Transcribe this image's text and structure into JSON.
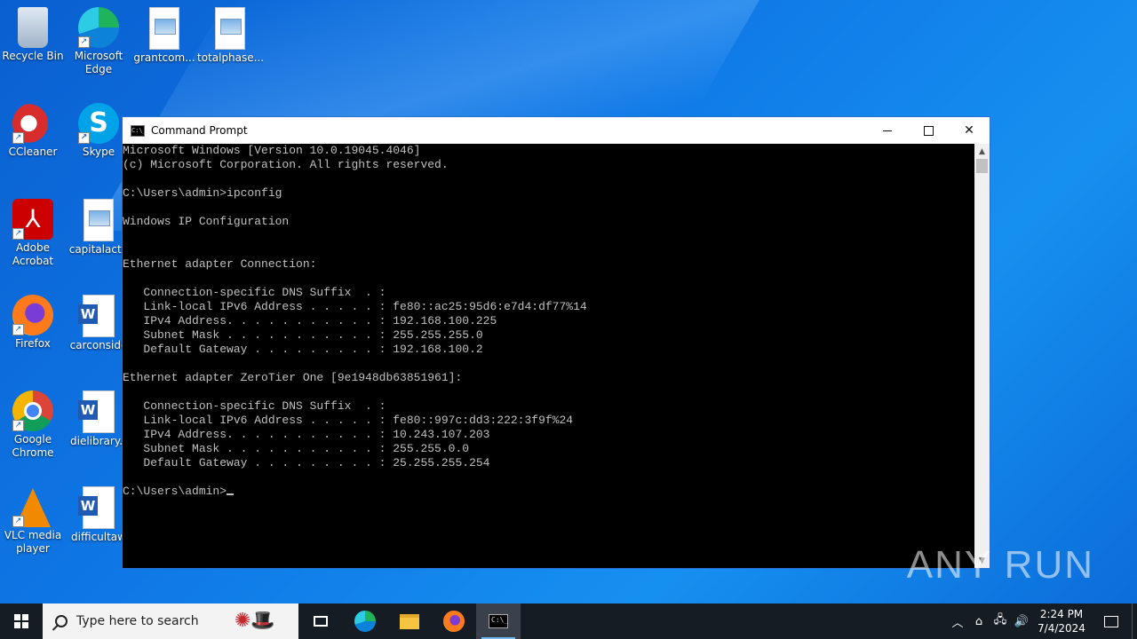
{
  "desktop": {
    "icons": [
      {
        "label": "Recycle Bin"
      },
      {
        "label": "Microsoft\nEdge"
      },
      {
        "label": "grantcom..."
      },
      {
        "label": "totalphase..."
      },
      {
        "label": "CCleaner"
      },
      {
        "label": "Skype"
      },
      {
        "label": "Adobe\nAcrobat"
      },
      {
        "label": "capitalactu"
      },
      {
        "label": "Firefox"
      },
      {
        "label": "carconside"
      },
      {
        "label": "Google\nChrome"
      },
      {
        "label": "dielibrary.r"
      },
      {
        "label": "VLC media\nplayer"
      },
      {
        "label": "difficultaw"
      }
    ]
  },
  "window": {
    "title": "Command Prompt",
    "icon_text": "C:\\_"
  },
  "console": {
    "lines": [
      "Microsoft Windows [Version 10.0.19045.4046]",
      "(c) Microsoft Corporation. All rights reserved.",
      "",
      "C:\\Users\\admin>ipconfig",
      "",
      "Windows IP Configuration",
      "",
      "",
      "Ethernet adapter Connection:",
      "",
      "   Connection-specific DNS Suffix  . :",
      "   Link-local IPv6 Address . . . . . : fe80::ac25:95d6:e7d4:df77%14",
      "   IPv4 Address. . . . . . . . . . . : 192.168.100.225",
      "   Subnet Mask . . . . . . . . . . . : 255.255.255.0",
      "   Default Gateway . . . . . . . . . : 192.168.100.2",
      "",
      "Ethernet adapter ZeroTier One [9e1948db63851961]:",
      "",
      "   Connection-specific DNS Suffix  . :",
      "   Link-local IPv6 Address . . . . . : fe80::997c:dd3:222:3f9f%24",
      "   IPv4 Address. . . . . . . . . . . : 10.243.107.203",
      "   Subnet Mask . . . . . . . . . . . : 255.255.0.0",
      "   Default Gateway . . . . . . . . . : 25.255.255.254",
      "",
      "C:\\Users\\admin>"
    ]
  },
  "watermark": "ANY RUN",
  "taskbar": {
    "search_placeholder": "Type here to search",
    "time": "2:24 PM",
    "date": "7/4/2024"
  }
}
